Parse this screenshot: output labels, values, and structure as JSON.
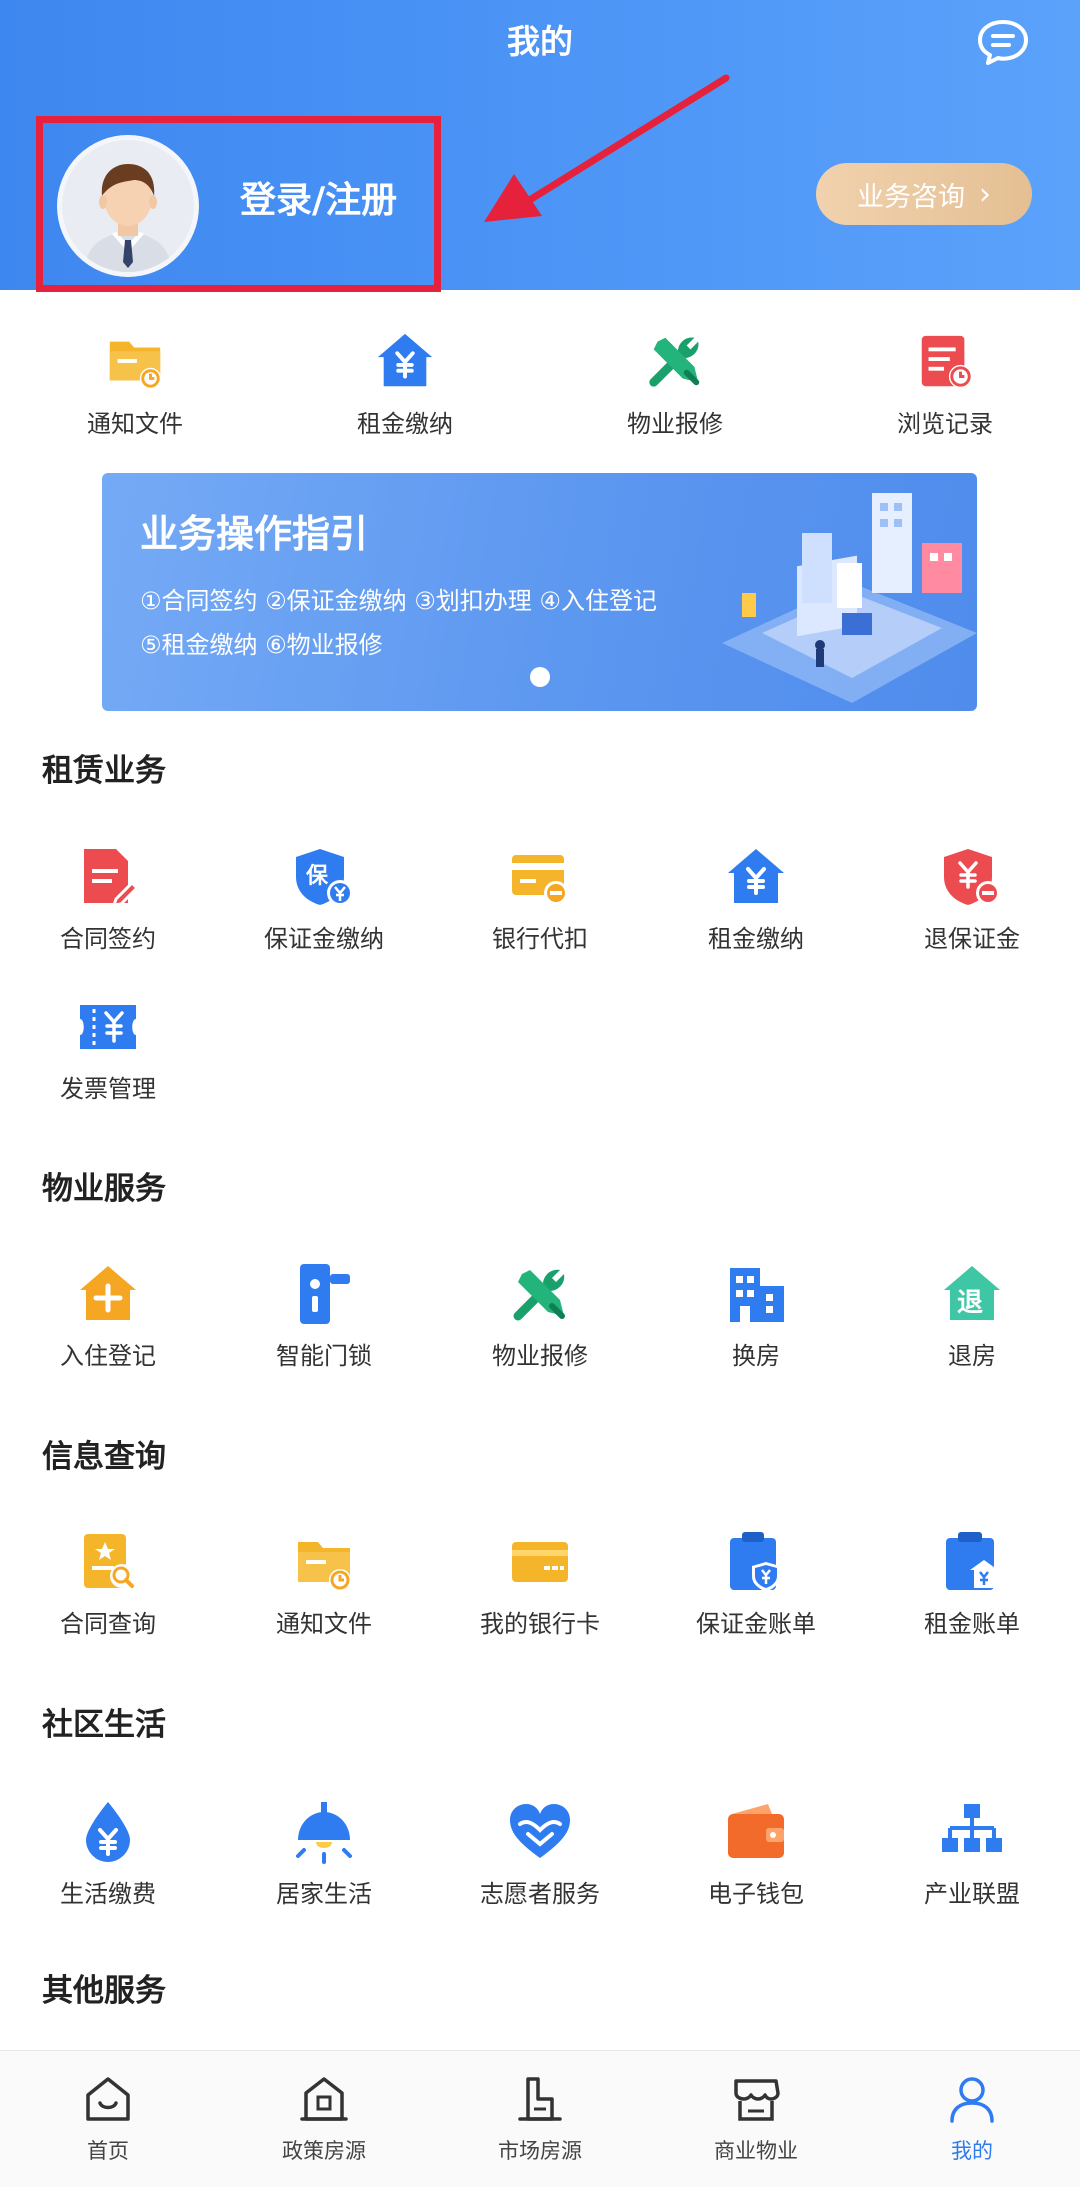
{
  "header": {
    "title": "我的",
    "login_label": "登录/注册",
    "consult_label": "业务咨询",
    "consult_chevron": "›",
    "annotation_color": "#e5213b"
  },
  "quick_links": [
    {
      "label": "通知文件",
      "icon": "folder-clock-icon"
    },
    {
      "label": "租金缴纳",
      "icon": "house-yen-icon"
    },
    {
      "label": "物业报修",
      "icon": "tools-icon"
    },
    {
      "label": "浏览记录",
      "icon": "document-clock-icon"
    }
  ],
  "banner": {
    "title": "业务操作指引",
    "line1": "①合同签约 ②保证金缴纳 ③划扣办理 ④入住登记",
    "line2": "⑤租金缴纳 ⑥物业报修"
  },
  "sections": [
    {
      "title": "租赁业务",
      "items": [
        {
          "label": "合同签约",
          "icon": "contract-sign-icon"
        },
        {
          "label": "保证金缴纳",
          "icon": "deposit-shield-icon"
        },
        {
          "label": "银行代扣",
          "icon": "bank-card-minus-icon"
        },
        {
          "label": "租金缴纳",
          "icon": "house-yen-icon"
        },
        {
          "label": "退保证金",
          "icon": "shield-yen-minus-icon"
        },
        {
          "label": "发票管理",
          "icon": "invoice-ticket-icon"
        }
      ]
    },
    {
      "title": "物业服务",
      "items": [
        {
          "label": "入住登记",
          "icon": "house-plus-icon"
        },
        {
          "label": "智能门锁",
          "icon": "smart-lock-icon"
        },
        {
          "label": "物业报修",
          "icon": "tools-icon"
        },
        {
          "label": "换房",
          "icon": "building-icon"
        },
        {
          "label": "退房",
          "icon": "house-return-icon"
        }
      ]
    },
    {
      "title": "信息查询",
      "items": [
        {
          "label": "合同查询",
          "icon": "contract-search-icon"
        },
        {
          "label": "通知文件",
          "icon": "folder-clock-icon"
        },
        {
          "label": "我的银行卡",
          "icon": "bank-card-icon"
        },
        {
          "label": "保证金账单",
          "icon": "clipboard-shield-icon"
        },
        {
          "label": "租金账单",
          "icon": "clipboard-yen-icon"
        }
      ]
    },
    {
      "title": "社区生活",
      "items": [
        {
          "label": "生活缴费",
          "icon": "water-drop-yen-icon"
        },
        {
          "label": "居家生活",
          "icon": "lamp-icon"
        },
        {
          "label": "志愿者服务",
          "icon": "heart-hands-icon"
        },
        {
          "label": "电子钱包",
          "icon": "wallet-icon"
        },
        {
          "label": "产业联盟",
          "icon": "org-chart-icon"
        }
      ]
    },
    {
      "title": "其他服务",
      "items": []
    }
  ],
  "tabbar": [
    {
      "label": "首页",
      "icon": "home-icon",
      "active": false
    },
    {
      "label": "政策房源",
      "icon": "policy-house-icon",
      "active": false
    },
    {
      "label": "市场房源",
      "icon": "market-house-icon",
      "active": false
    },
    {
      "label": "商业物业",
      "icon": "shop-icon",
      "active": false
    },
    {
      "label": "我的",
      "icon": "user-icon",
      "active": true
    }
  ]
}
